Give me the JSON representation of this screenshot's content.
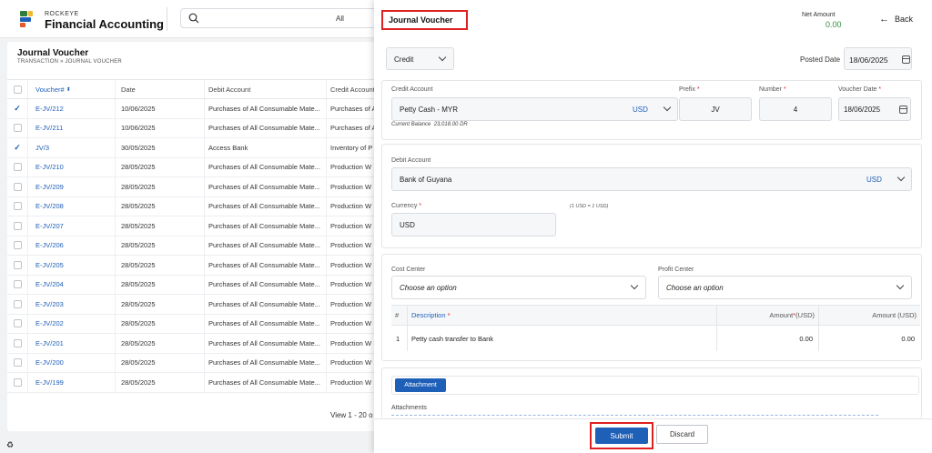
{
  "header": {
    "brand_small": "ROCKEYE",
    "brand_big": "Financial Accounting",
    "search_filter": "All"
  },
  "list": {
    "title": "Journal Voucher",
    "breadcrumb": "TRANSACTION  »  JOURNAL VOUCHER",
    "columns": [
      "Voucher#",
      "Date",
      "Debit Account",
      "Credit Account"
    ],
    "rows": [
      {
        "checked": true,
        "voucher": "E-JV/212",
        "date": "10/06/2025",
        "debit": "Purchases of All Consumable Mate...",
        "credit": "Purchases of A"
      },
      {
        "checked": false,
        "voucher": "E-JV/211",
        "date": "10/06/2025",
        "debit": "Purchases of All Consumable Mate...",
        "credit": "Purchases of A"
      },
      {
        "checked": true,
        "voucher": "JV/3",
        "date": "30/05/2025",
        "debit": "Access Bank",
        "credit": "Inventory of P"
      },
      {
        "checked": false,
        "voucher": "E-JV/210",
        "date": "28/05/2025",
        "debit": "Purchases of All Consumable Mate...",
        "credit": "Production W"
      },
      {
        "checked": false,
        "voucher": "E-JV/209",
        "date": "28/05/2025",
        "debit": "Purchases of All Consumable Mate...",
        "credit": "Production W"
      },
      {
        "checked": false,
        "voucher": "E-JV/208",
        "date": "28/05/2025",
        "debit": "Purchases of All Consumable Mate...",
        "credit": "Production W"
      },
      {
        "checked": false,
        "voucher": "E-JV/207",
        "date": "28/05/2025",
        "debit": "Purchases of All Consumable Mate...",
        "credit": "Production W"
      },
      {
        "checked": false,
        "voucher": "E-JV/206",
        "date": "28/05/2025",
        "debit": "Purchases of All Consumable Mate...",
        "credit": "Production W"
      },
      {
        "checked": false,
        "voucher": "E-JV/205",
        "date": "28/05/2025",
        "debit": "Purchases of All Consumable Mate...",
        "credit": "Production W"
      },
      {
        "checked": false,
        "voucher": "E-JV/204",
        "date": "28/05/2025",
        "debit": "Purchases of All Consumable Mate...",
        "credit": "Production W"
      },
      {
        "checked": false,
        "voucher": "E-JV/203",
        "date": "28/05/2025",
        "debit": "Purchases of All Consumable Mate...",
        "credit": "Production W"
      },
      {
        "checked": false,
        "voucher": "E-JV/202",
        "date": "28/05/2025",
        "debit": "Purchases of All Consumable Mate...",
        "credit": "Production W"
      },
      {
        "checked": false,
        "voucher": "E-JV/201",
        "date": "28/05/2025",
        "debit": "Purchases of All Consumable Mate...",
        "credit": "Production W"
      },
      {
        "checked": false,
        "voucher": "E-JV/200",
        "date": "28/05/2025",
        "debit": "Purchases of All Consumable Mate...",
        "credit": "Production W"
      },
      {
        "checked": false,
        "voucher": "E-JV/199",
        "date": "28/05/2025",
        "debit": "Purchases of All Consumable Mate...",
        "credit": "Production W"
      }
    ],
    "pagination": "View 1 - 20 o"
  },
  "form": {
    "title": "Journal Voucher",
    "net_amount_label": "Net Amount",
    "net_amount_value": "0.00",
    "back_label": "Back",
    "type_value": "Credit",
    "posted_date_label": "Posted Date",
    "posted_date_value": "18/06/2025",
    "credit_account_label": "Credit Account",
    "credit_account_value": "Petty Cash - MYR",
    "credit_account_currency": "USD",
    "current_balance_label": "Current Balance",
    "current_balance_value": "23,018.00 DR",
    "prefix_label": "Prefix",
    "prefix_value": "JV",
    "number_label": "Number",
    "number_value": "4",
    "voucher_date_label": "Voucher Date",
    "voucher_date_value": "18/06/2025",
    "debit_account_label": "Debit Account",
    "debit_account_value": "Bank of Guyana",
    "debit_account_currency": "USD",
    "currency_label": "Currency",
    "currency_value": "USD",
    "rate_note": "(1 USD = 1 USD)",
    "cost_center_label": "Cost Center",
    "cost_center_placeholder": "Choose an option",
    "profit_center_label": "Profit Center",
    "profit_center_placeholder": "Choose an option",
    "lines_header": {
      "num": "#",
      "description": "Description",
      "amount": "Amount",
      "amount_unit": "(USD)",
      "amount2": "Amount (USD)"
    },
    "lines": [
      {
        "num": "1",
        "description": "Petty cash transfer to Bank",
        "amount": "0.00",
        "amount2": "0.00"
      }
    ],
    "attachment_button": "Attachment",
    "attachments_label": "Attachments",
    "submit_label": "Submit",
    "discard_label": "Discard"
  },
  "colors": {
    "primary": "#1e5fb8",
    "highlight": "#e02020",
    "positive": "#2f8f3a"
  }
}
